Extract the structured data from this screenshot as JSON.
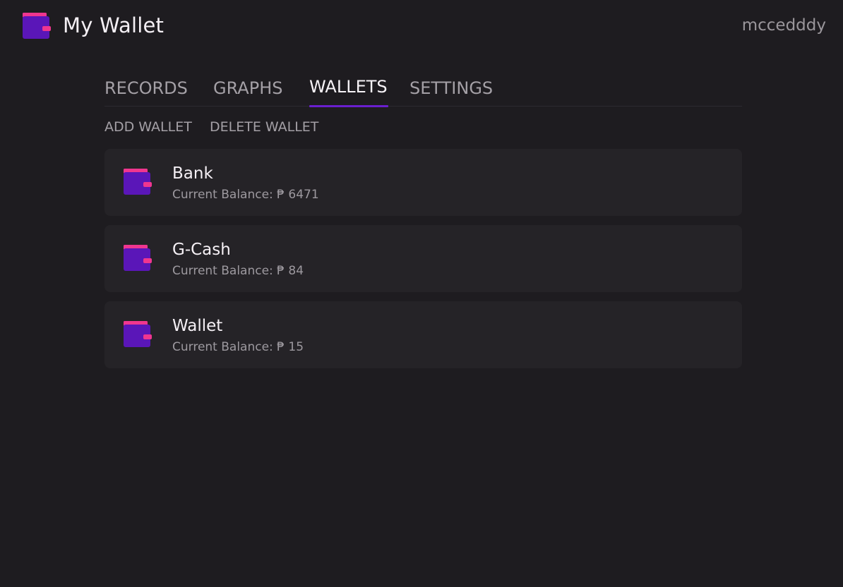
{
  "app": {
    "title": "My Wallet",
    "username": "mccedddy"
  },
  "tabs": [
    {
      "label": "RECORDS",
      "active": false
    },
    {
      "label": "GRAPHS",
      "active": false
    },
    {
      "label": "WALLETS",
      "active": true
    },
    {
      "label": "SETTINGS",
      "active": false
    }
  ],
  "actions": {
    "add_label": "ADD WALLET",
    "delete_label": "DELETE WALLET"
  },
  "wallets": [
    {
      "name": "Bank",
      "balance_text": "Current Balance: ₱ 6471"
    },
    {
      "name": "G-Cash",
      "balance_text": "Current Balance: ₱ 84"
    },
    {
      "name": "Wallet",
      "balance_text": "Current Balance: ₱ 15"
    }
  ],
  "icons": {
    "wallet": "wallet-icon",
    "logo": "wallet-logo-icon"
  },
  "colors": {
    "background": "#1e1c20",
    "card": "#252327",
    "accent_purple": "#6a1fcf",
    "accent_pink": "#f0368f"
  }
}
